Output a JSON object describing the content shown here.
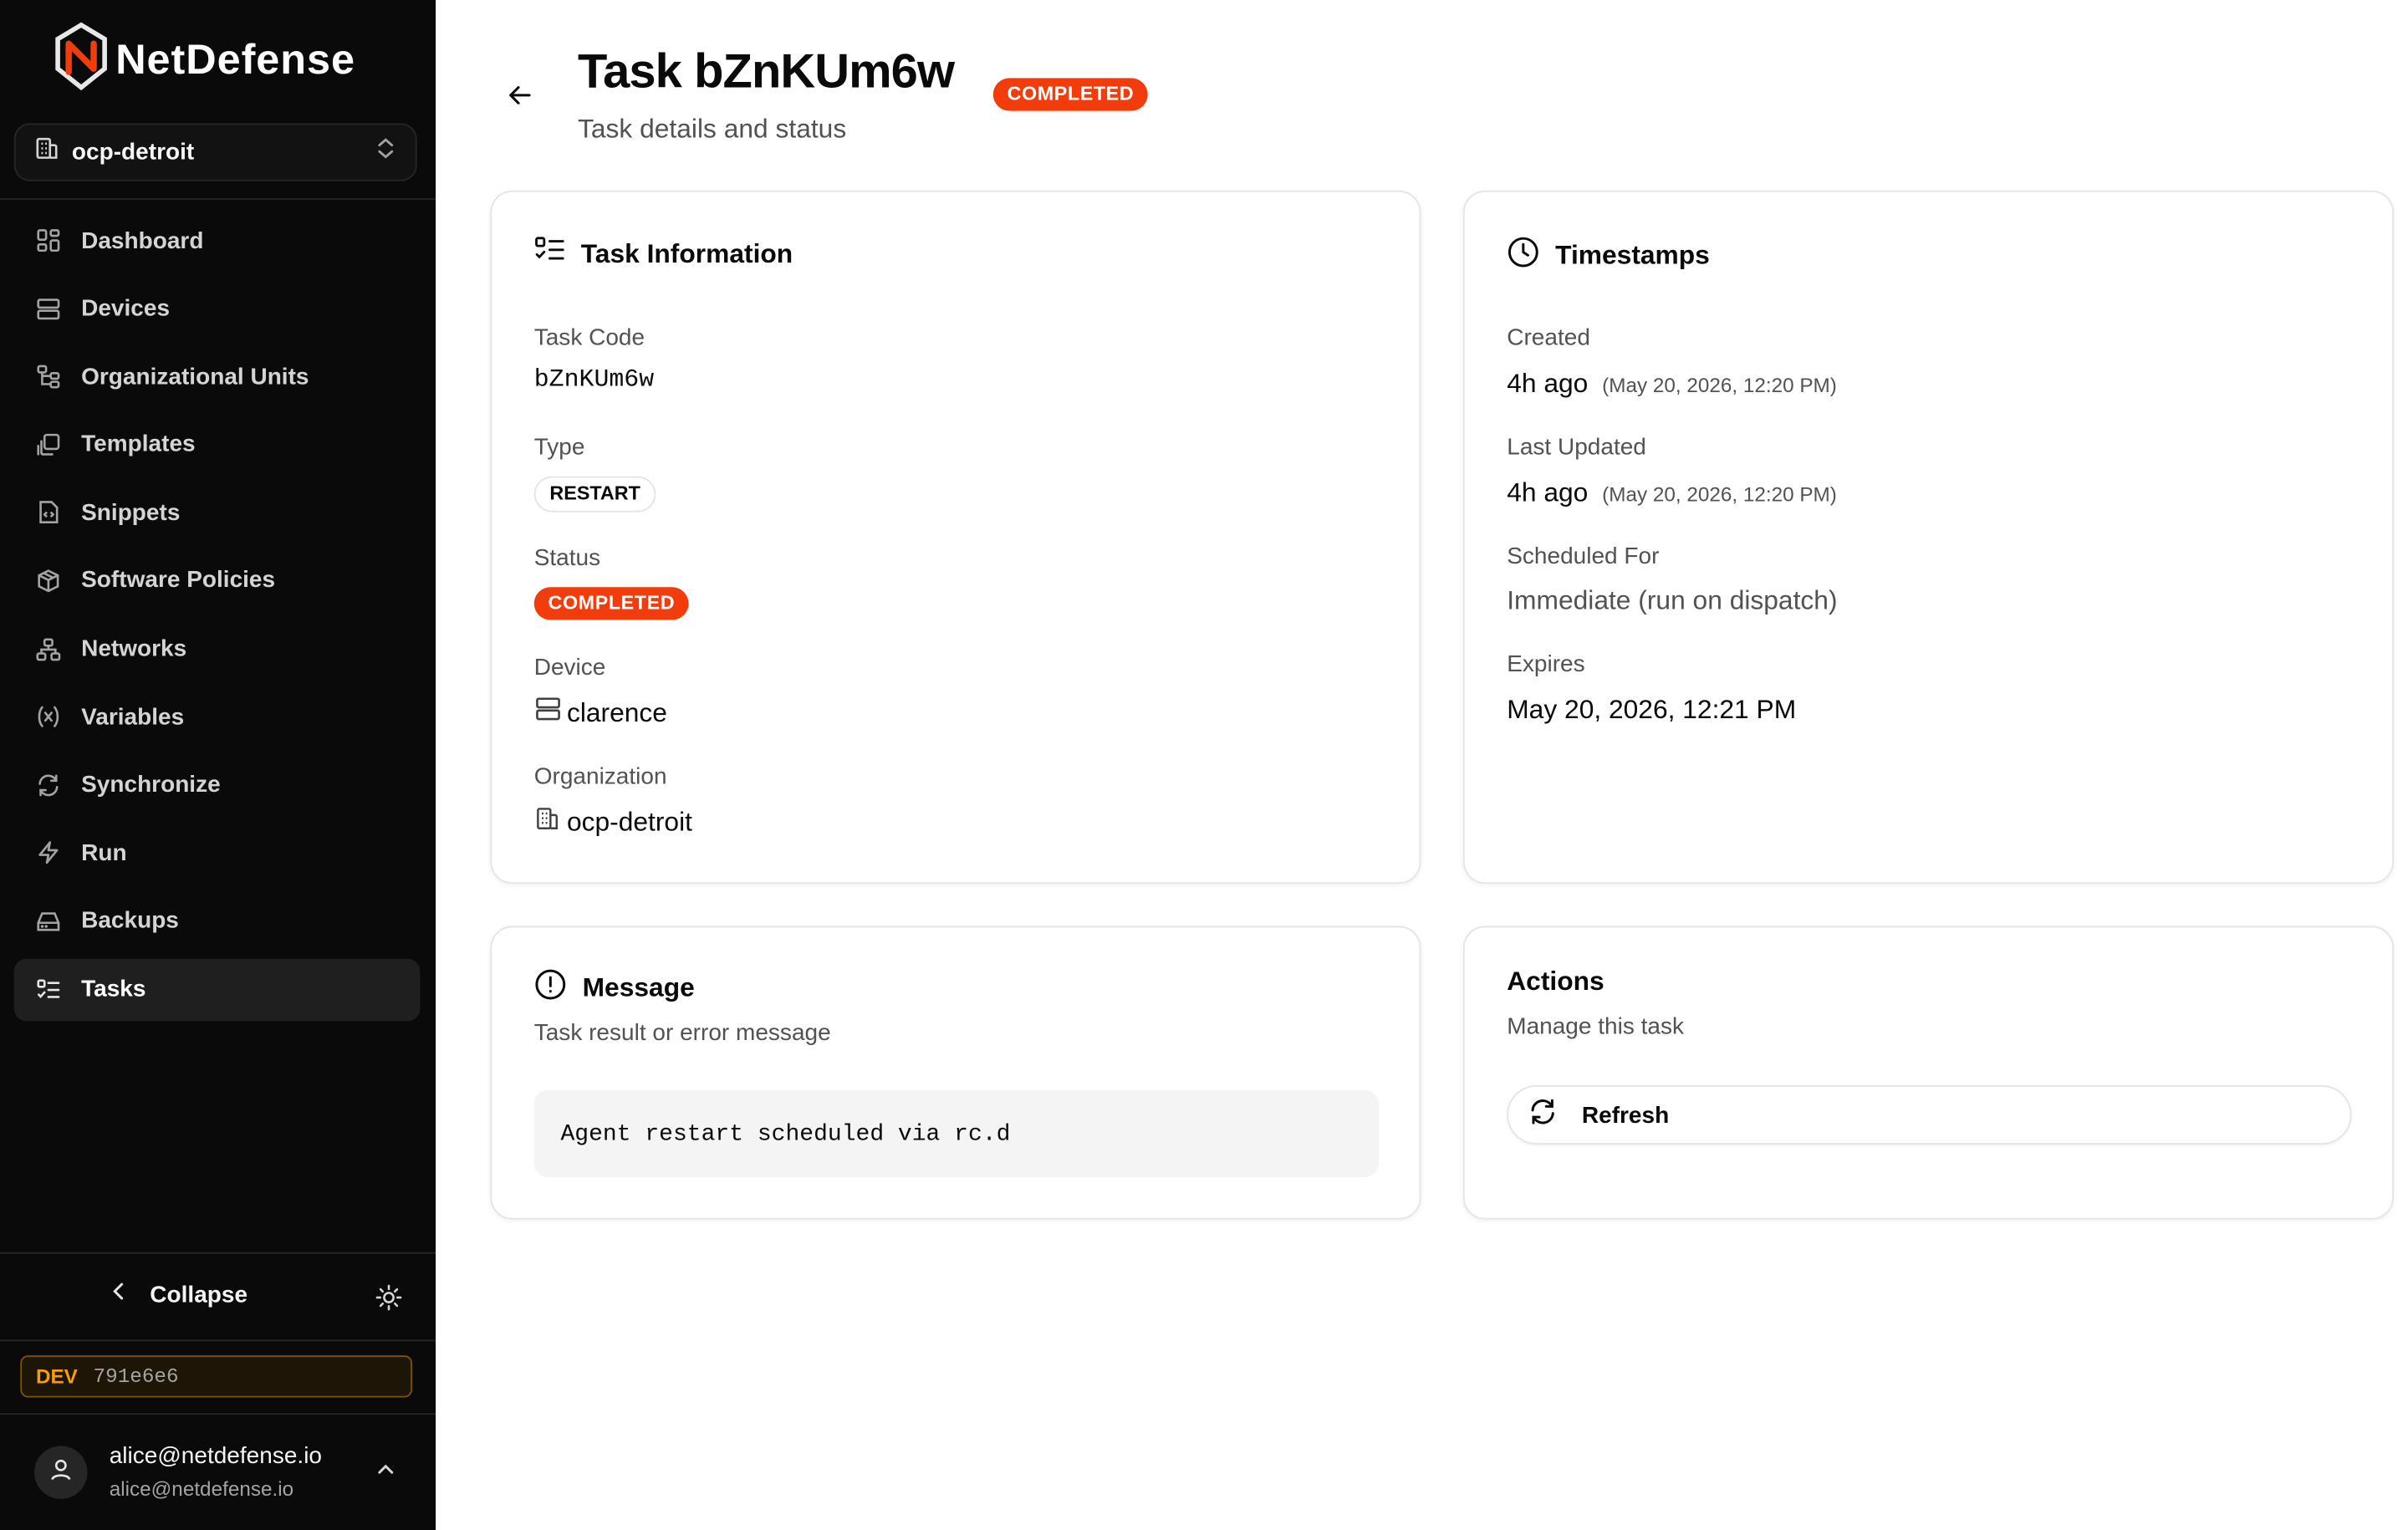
{
  "sidebar": {
    "brand": "NetDefense",
    "org_select": "ocp-detroit",
    "items": [
      {
        "label": "Dashboard",
        "icon": "dashboard-icon"
      },
      {
        "label": "Devices",
        "icon": "server-icon"
      },
      {
        "label": "Organizational Units",
        "icon": "org-tree-icon"
      },
      {
        "label": "Templates",
        "icon": "templates-icon"
      },
      {
        "label": "Snippets",
        "icon": "file-code-icon"
      },
      {
        "label": "Software Policies",
        "icon": "package-icon"
      },
      {
        "label": "Networks",
        "icon": "network-icon"
      },
      {
        "label": "Variables",
        "icon": "variable-icon"
      },
      {
        "label": "Synchronize",
        "icon": "refresh-icon"
      },
      {
        "label": "Run",
        "icon": "bolt-icon"
      },
      {
        "label": "Backups",
        "icon": "hard-drive-icon"
      },
      {
        "label": "Tasks",
        "icon": "list-checks-icon",
        "active": true
      }
    ],
    "collapse_label": "Collapse",
    "env_badge": {
      "env": "DEV",
      "commit": "791e6e6"
    },
    "user": {
      "name": "alice@netdefense.io",
      "email": "alice@netdefense.io"
    }
  },
  "header": {
    "title": "Task bZnKUm6w",
    "subtitle": "Task details and status",
    "status_badge": "COMPLETED"
  },
  "task_info": {
    "heading": "Task Information",
    "task_code_label": "Task Code",
    "task_code": "bZnKUm6w",
    "type_label": "Type",
    "type": "RESTART",
    "status_label": "Status",
    "status": "COMPLETED",
    "device_label": "Device",
    "device": "clarence",
    "org_label": "Organization",
    "org": "ocp-detroit"
  },
  "timestamps": {
    "heading": "Timestamps",
    "created_label": "Created",
    "created_rel": "4h ago",
    "created_abs": "(May 20, 2026, 12:20 PM)",
    "updated_label": "Last Updated",
    "updated_rel": "4h ago",
    "updated_abs": "(May 20, 2026, 12:20 PM)",
    "scheduled_label": "Scheduled For",
    "scheduled": "Immediate (run on dispatch)",
    "expires_label": "Expires",
    "expires": "May 20, 2026, 12:21 PM"
  },
  "message": {
    "heading": "Message",
    "subtitle": "Task result or error message",
    "body": "Agent restart scheduled via rc.d"
  },
  "actions": {
    "heading": "Actions",
    "subtitle": "Manage this task",
    "refresh_label": "Refresh"
  },
  "colors": {
    "sidebar_bg": "#0a0a0a",
    "accent_red": "#f23c0c",
    "dev_amber": "#f59e0b"
  }
}
